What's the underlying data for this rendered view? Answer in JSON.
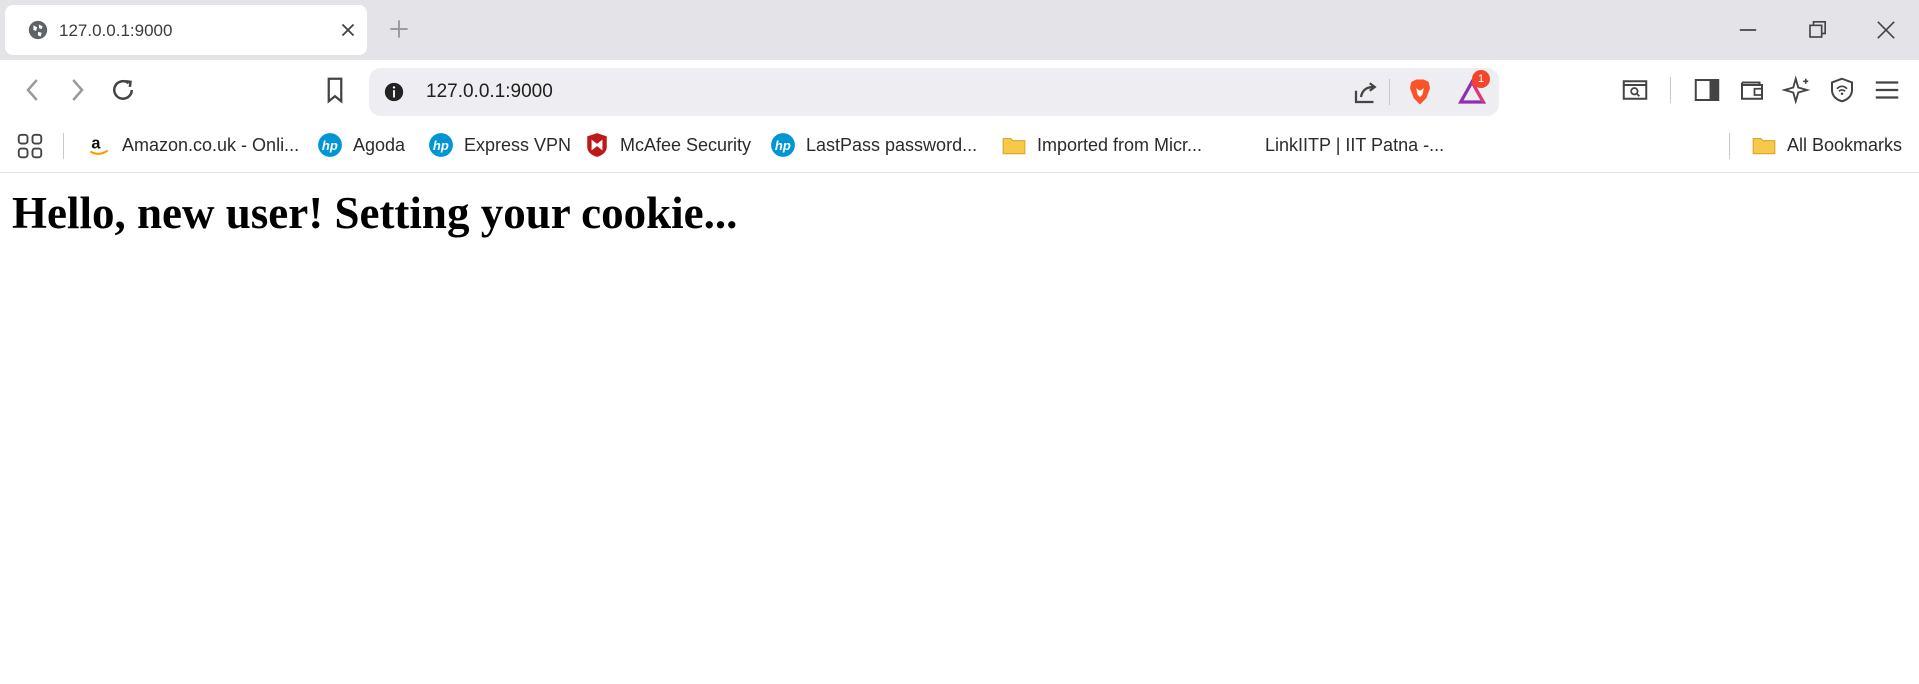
{
  "tab": {
    "title": "127.0.0.1:9000"
  },
  "address_bar": {
    "url": "127.0.0.1:9000"
  },
  "rewards_badge": "1",
  "bookmarks": [
    {
      "label": "Amazon.co.uk - Onli...",
      "icon": "amazon-icon"
    },
    {
      "label": "Agoda",
      "icon": "hp-icon"
    },
    {
      "label": "Express VPN",
      "icon": "hp-icon"
    },
    {
      "label": "McAfee Security",
      "icon": "mcafee-icon"
    },
    {
      "label": "LastPass password...",
      "icon": "hp-icon"
    },
    {
      "label": "Imported from Micr...",
      "icon": "folder-icon"
    },
    {
      "label": "LinkIITP | IIT Patna -...",
      "icon": "none"
    }
  ],
  "all_bookmarks": {
    "label": "All Bookmarks",
    "icon": "folder-icon"
  },
  "page": {
    "heading": "Hello, new user! Setting your cookie..."
  },
  "colors": {
    "tabstrip": "#e3e3e8",
    "omnibox": "#eeeef2",
    "brave_orange": "#fb542b",
    "hp_blue": "#0096d6",
    "mcafee_red": "#c01818",
    "folder_yellow": "#f6c94a"
  }
}
